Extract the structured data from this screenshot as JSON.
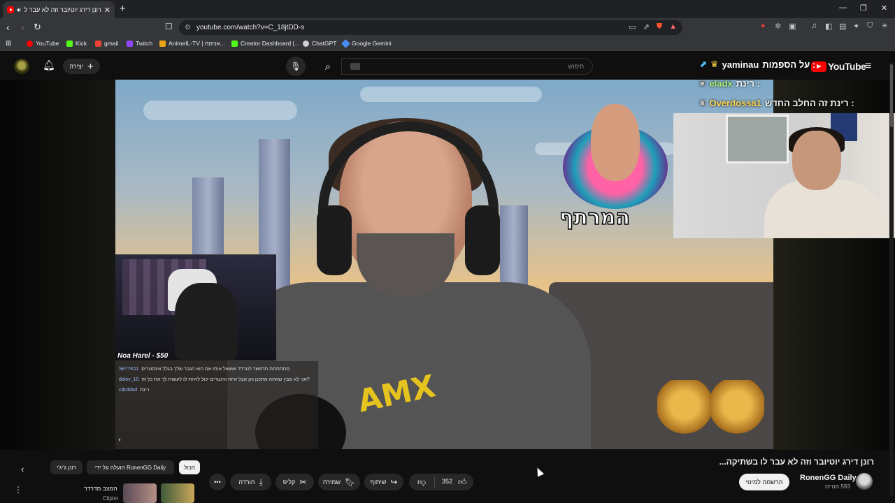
{
  "browser": {
    "tab_title": "רונן דירג יוטיובר וזה לא עבר לו",
    "url": "youtube.com/watch?v=C_18jtDD-s",
    "new_tab_symbol": "+",
    "bookmarks": [
      {
        "label": "YouTube",
        "color": "#ff0000"
      },
      {
        "label": "Kick",
        "color": "#53fc18"
      },
      {
        "label": "gmail",
        "color": "#ea4335"
      },
      {
        "label": "Twitch",
        "color": "#9146ff"
      },
      {
        "label": "AnimeIL-TV | אנימה...",
        "color": "#e8a317"
      },
      {
        "label": "Creator Dashboard |...",
        "color": "#53fc18"
      },
      {
        "label": "ChatGPT",
        "color": "#cfcfcf"
      },
      {
        "label": "Google Gemini",
        "color": "#4b8bf5"
      }
    ]
  },
  "youtube": {
    "create_label": "יצירה",
    "search_placeholder": "חיפוש",
    "logo_text": "YouTube"
  },
  "stream_chat": [
    {
      "user": "yaminau",
      "text": "על הספמות :",
      "user_color": "#ffffff"
    },
    {
      "user": "eladx",
      "text": "רינת :",
      "user_color": "#a7f27a"
    },
    {
      "user": "Overdossa1",
      "text": "רינת זה החלב החדש :",
      "user_color": "#ffd54f"
    }
  ],
  "video_overlay": {
    "donation": "Noa Harel - $50",
    "chat": [
      {
        "name": "Se77K11",
        "text": "מתתתתת תרפשר לטרדד ואשאל אותו אם הוא הגבר שלך בגלל אינסטרים"
      },
      {
        "name": "dolev_10",
        "text": "אני לא מבין שאתה מתכנן ווק אבל איזה אינטרים יכול להיות לו לעשות לך את כל זה?"
      },
      {
        "name": "cdcddsd",
        "text": "רינת"
      }
    ],
    "logo_text": "המרתף",
    "shirt_text": "AMX"
  },
  "video": {
    "title": "רונן דירג יוטיובר וזה לא עבר לו בשתיקה...",
    "channel": "RonenGG Daily",
    "subscribers": "593 מנויים",
    "subscribe_label": "הרשמה למינוי",
    "likes": "352",
    "share_label": "שיתוף",
    "save_label": "שמירה",
    "clip_label": "קליפ",
    "download_label": "הורדה"
  },
  "chips": [
    {
      "label": "הכול",
      "selected": true
    },
    {
      "label": "הועלה על ידי RonenGG Daily",
      "selected": false
    },
    {
      "label": "רונן ג'יג'י",
      "selected": false
    }
  ],
  "recommendation": {
    "title": "המצב מדרדר",
    "channel": "Clipim"
  }
}
